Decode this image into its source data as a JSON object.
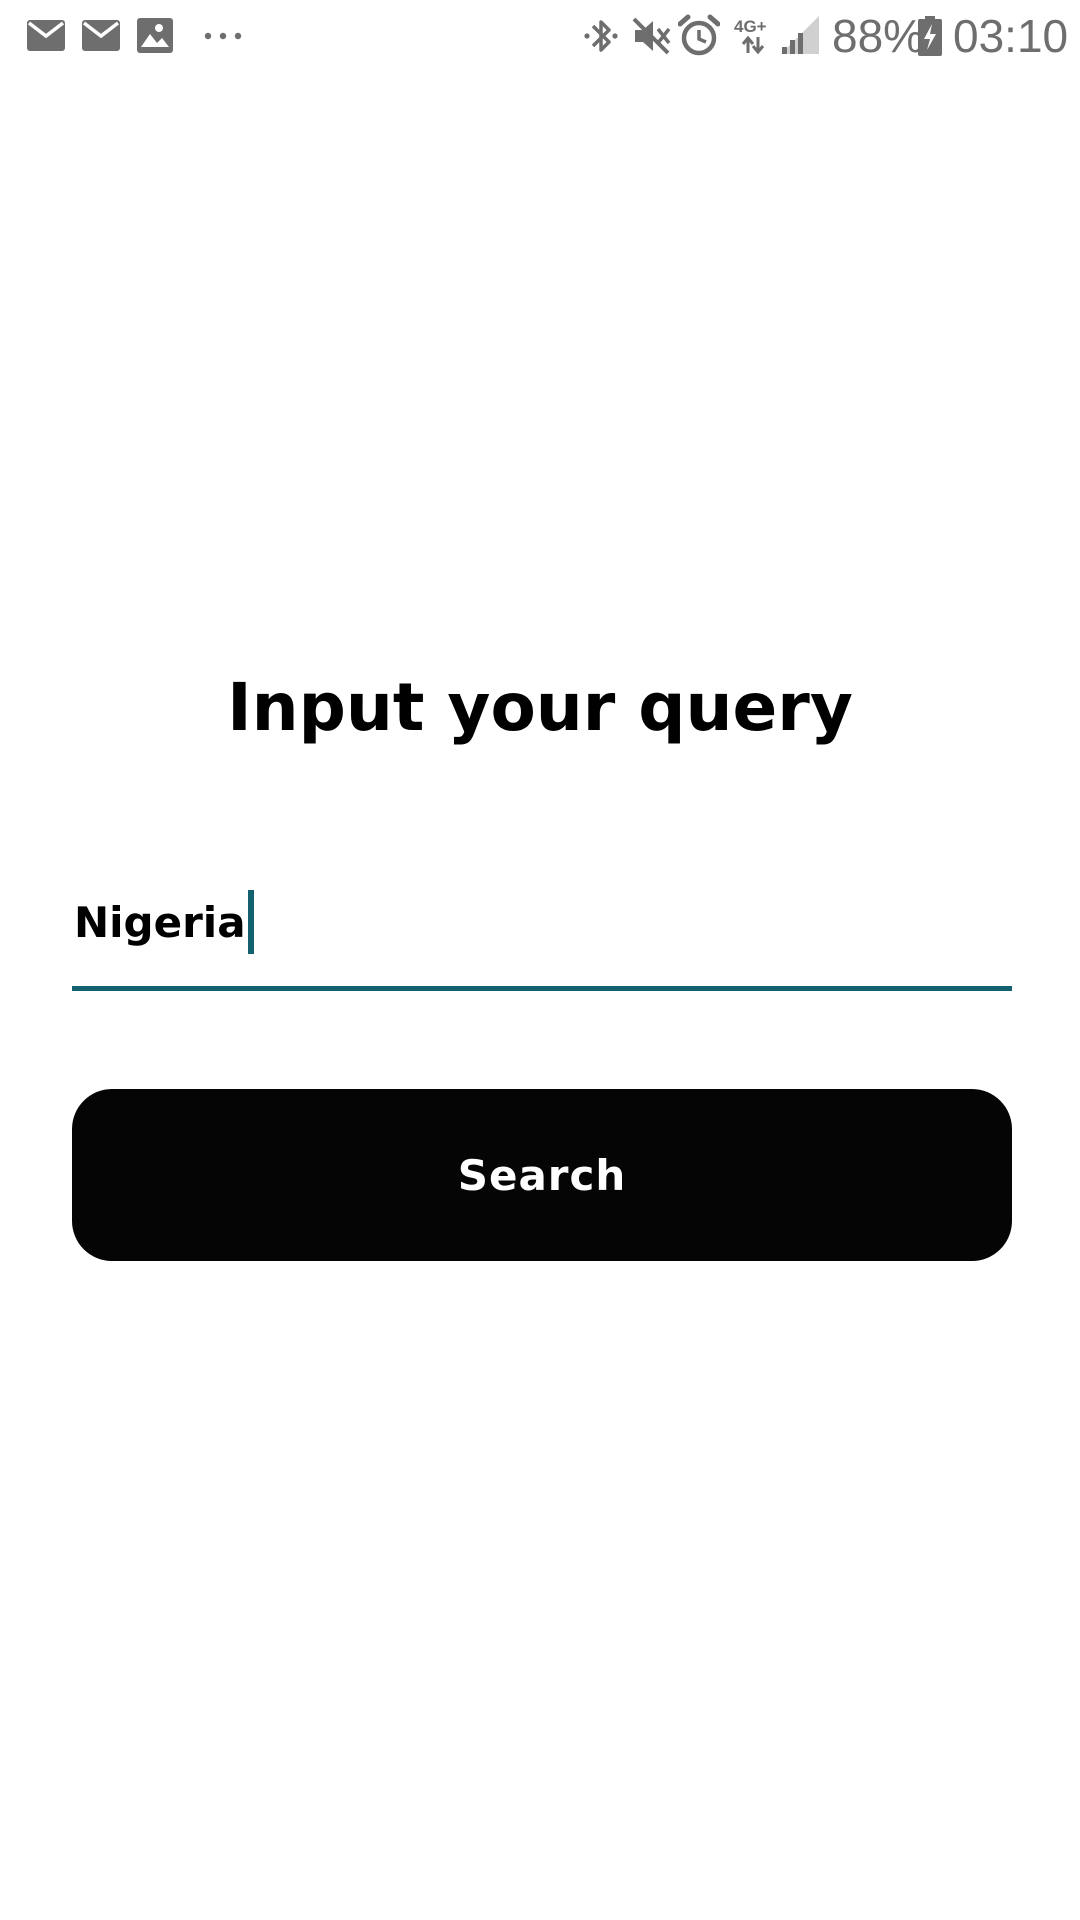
{
  "status_bar": {
    "left_icons": [
      "mail-icon",
      "mail-icon",
      "image-icon",
      "more-dots-icon"
    ],
    "right_icons": [
      "bluetooth-icon",
      "mute-icon",
      "alarm-icon",
      "network-4g-plus-icon",
      "signal-icon",
      "battery-charging-icon"
    ],
    "network_label": "4G+",
    "battery_percent": "88%",
    "time": "03:10"
  },
  "main": {
    "title": "Input your query",
    "query_input": {
      "value": "Nigeria",
      "placeholder": ""
    },
    "search_button_label": "Search"
  },
  "colors": {
    "accent": "#13616f",
    "button_bg": "#050505",
    "button_text": "#ffffff",
    "status_icons": "#6e6e6e"
  }
}
